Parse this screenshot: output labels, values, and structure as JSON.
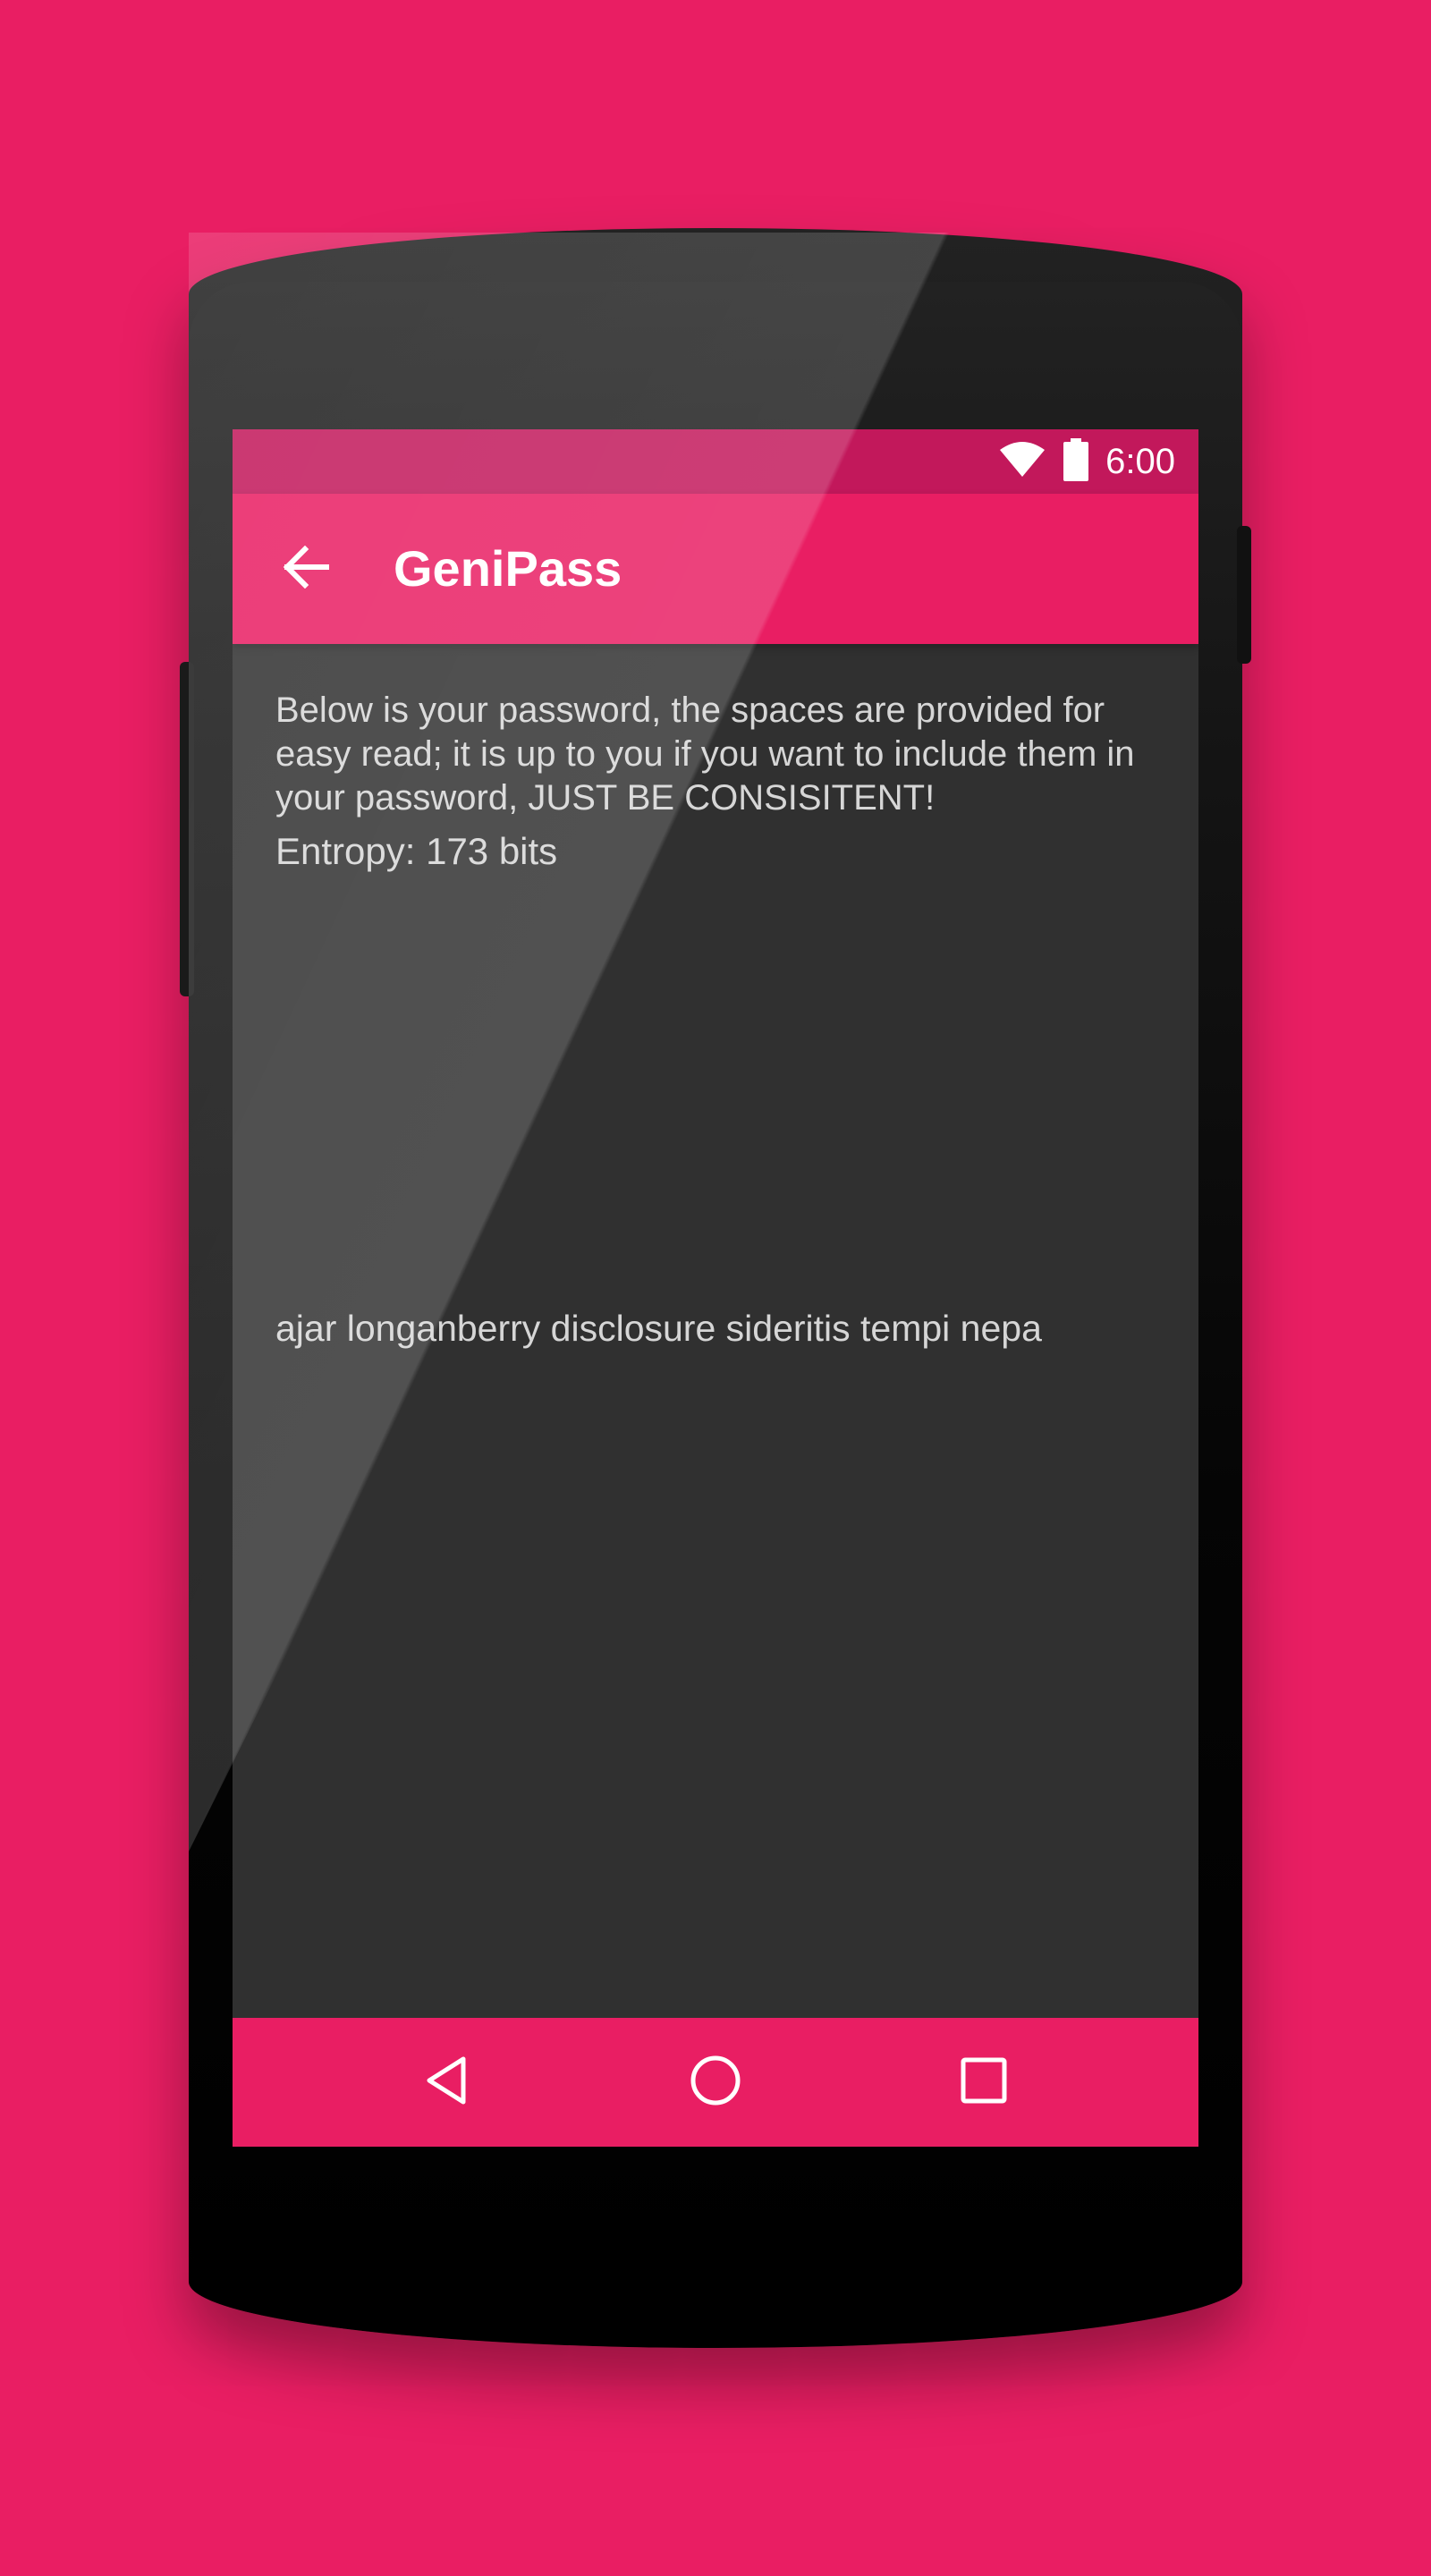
{
  "status_bar": {
    "time": "6:00",
    "icons": [
      "wifi-icon",
      "battery-icon"
    ]
  },
  "app_bar": {
    "title": "GeniPass",
    "back_icon": "arrow-back-icon"
  },
  "content": {
    "info": "Below is your password, the spaces are provided for easy read; it is up to you if you want to include them in your password, JUST BE CONSISITENT!",
    "entropy": "Entropy: 173 bits",
    "password": "ajar longanberry disclosure sideritis tempi nepa"
  },
  "nav_bar": {
    "icons": [
      "back-triangle-icon",
      "home-circle-icon",
      "recents-square-icon"
    ]
  },
  "colors": {
    "background": "#E91E63",
    "status_bar": "#C2185B",
    "app_bar": "#E91E63",
    "screen": "#303030",
    "text": "#D6D6D6"
  }
}
